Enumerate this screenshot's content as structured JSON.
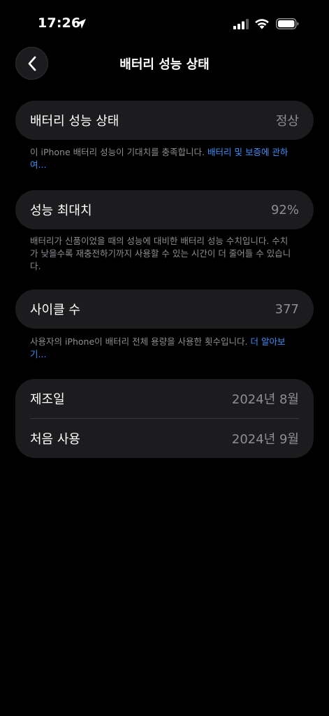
{
  "status_bar": {
    "time": "17:26",
    "icons": [
      "location-arrow-icon",
      "cellular-signal-icon",
      "wifi-icon",
      "battery-icon"
    ]
  },
  "nav": {
    "back_icon": "chevron-left-icon",
    "title": "배터리 성능 상태"
  },
  "health": {
    "label": "배터리 성능 상태",
    "value": "정상",
    "footnote_text": "이 iPhone 배터리 성능이 기대치를 충족합니다. ",
    "footnote_link": "배터리 및 보증에 관하여..."
  },
  "max_capacity": {
    "label": "성능 최대치",
    "value": "92%",
    "footnote_text": "배터리가 신품이었을 때의 성능에 대비한 배터리 성능 수치입니다. 수치가 낮을수록 재충전하기까지 사용할 수 있는 시간이 더 줄어들 수 있습니다."
  },
  "cycle_count": {
    "label": "사이클 수",
    "value": "377",
    "footnote_text": "사용자의 iPhone이 배터리 전체 용량을 사용한 횟수입니다. ",
    "footnote_link": "더 알아보기..."
  },
  "dates": {
    "manufacture_label": "제조일",
    "manufacture_value": "2024년 8월",
    "first_use_label": "처음 사용",
    "first_use_value": "2024년 9월"
  },
  "colors": {
    "background": "#000000",
    "card": "#1c1c1e",
    "secondary_text": "#8e8e93",
    "link": "#3e8ef7"
  }
}
